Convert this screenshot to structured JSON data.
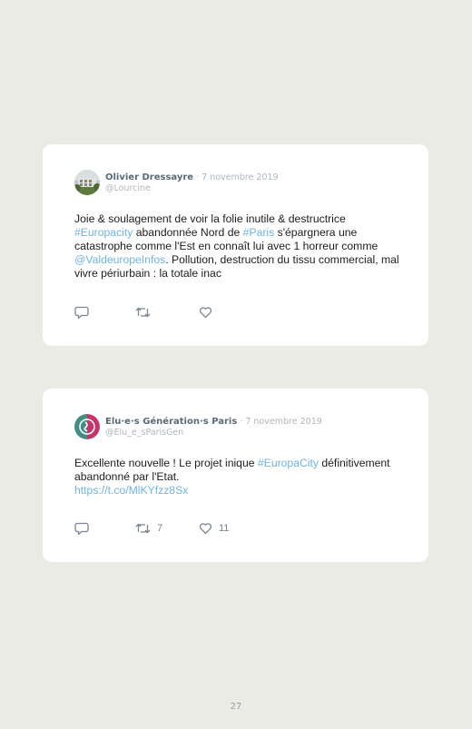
{
  "tweets": [
    {
      "author_name": "Olivier Dressayre",
      "date": " · 7 novembre 2019",
      "handle": "@Lourcine",
      "avatar_icon": "building-photo-avatar",
      "text_parts": [
        {
          "t": "Joie & soulagement de voir la folie inutile & destructrice ",
          "link": false
        },
        {
          "t": "#Europacity",
          "link": true
        },
        {
          "t": " abandonnée Nord de ",
          "link": false
        },
        {
          "t": "#Paris",
          "link": true
        },
        {
          "t": " s'épargnera une catastrophe comme l'Est en connaît lui avec 1 horreur comme ",
          "link": false
        },
        {
          "t": "@ValdeuropeInfos",
          "link": true
        },
        {
          "t": ". Pollution, destruction du tissu commercial, mal vivre périurbain : la totale inac",
          "link": false
        }
      ],
      "actions": {
        "reply_icon": "reply-icon",
        "retweet_icon": "retweet-icon",
        "like_icon": "heart-icon",
        "retweet_count": "",
        "like_count": ""
      }
    },
    {
      "author_name": "Elu·e·s Génération·s Paris",
      "date": " · 7 novembre 2019",
      "handle": "@Elu_e_sParisGen",
      "avatar_icon": "generations-logo-avatar",
      "text_parts": [
        {
          "t": "Excellente nouvelle ! Le projet inique ",
          "link": false
        },
        {
          "t": "#EuropaCity",
          "link": true
        },
        {
          "t": " définitivement abandonné par l'Etat.\n",
          "link": false
        },
        {
          "t": "https://t.co/MlKYfzz8Sx",
          "link": true
        }
      ],
      "actions": {
        "reply_icon": "reply-icon",
        "retweet_icon": "retweet-icon",
        "like_icon": "heart-icon",
        "retweet_count": "7",
        "like_count": "11"
      }
    }
  ],
  "colors": {
    "page_background": "#ebebe6",
    "card_background": "#ffffff",
    "link": "#6fb4df",
    "name": "#5b6a78",
    "muted": "#aeb6bd"
  },
  "page_number": "27"
}
